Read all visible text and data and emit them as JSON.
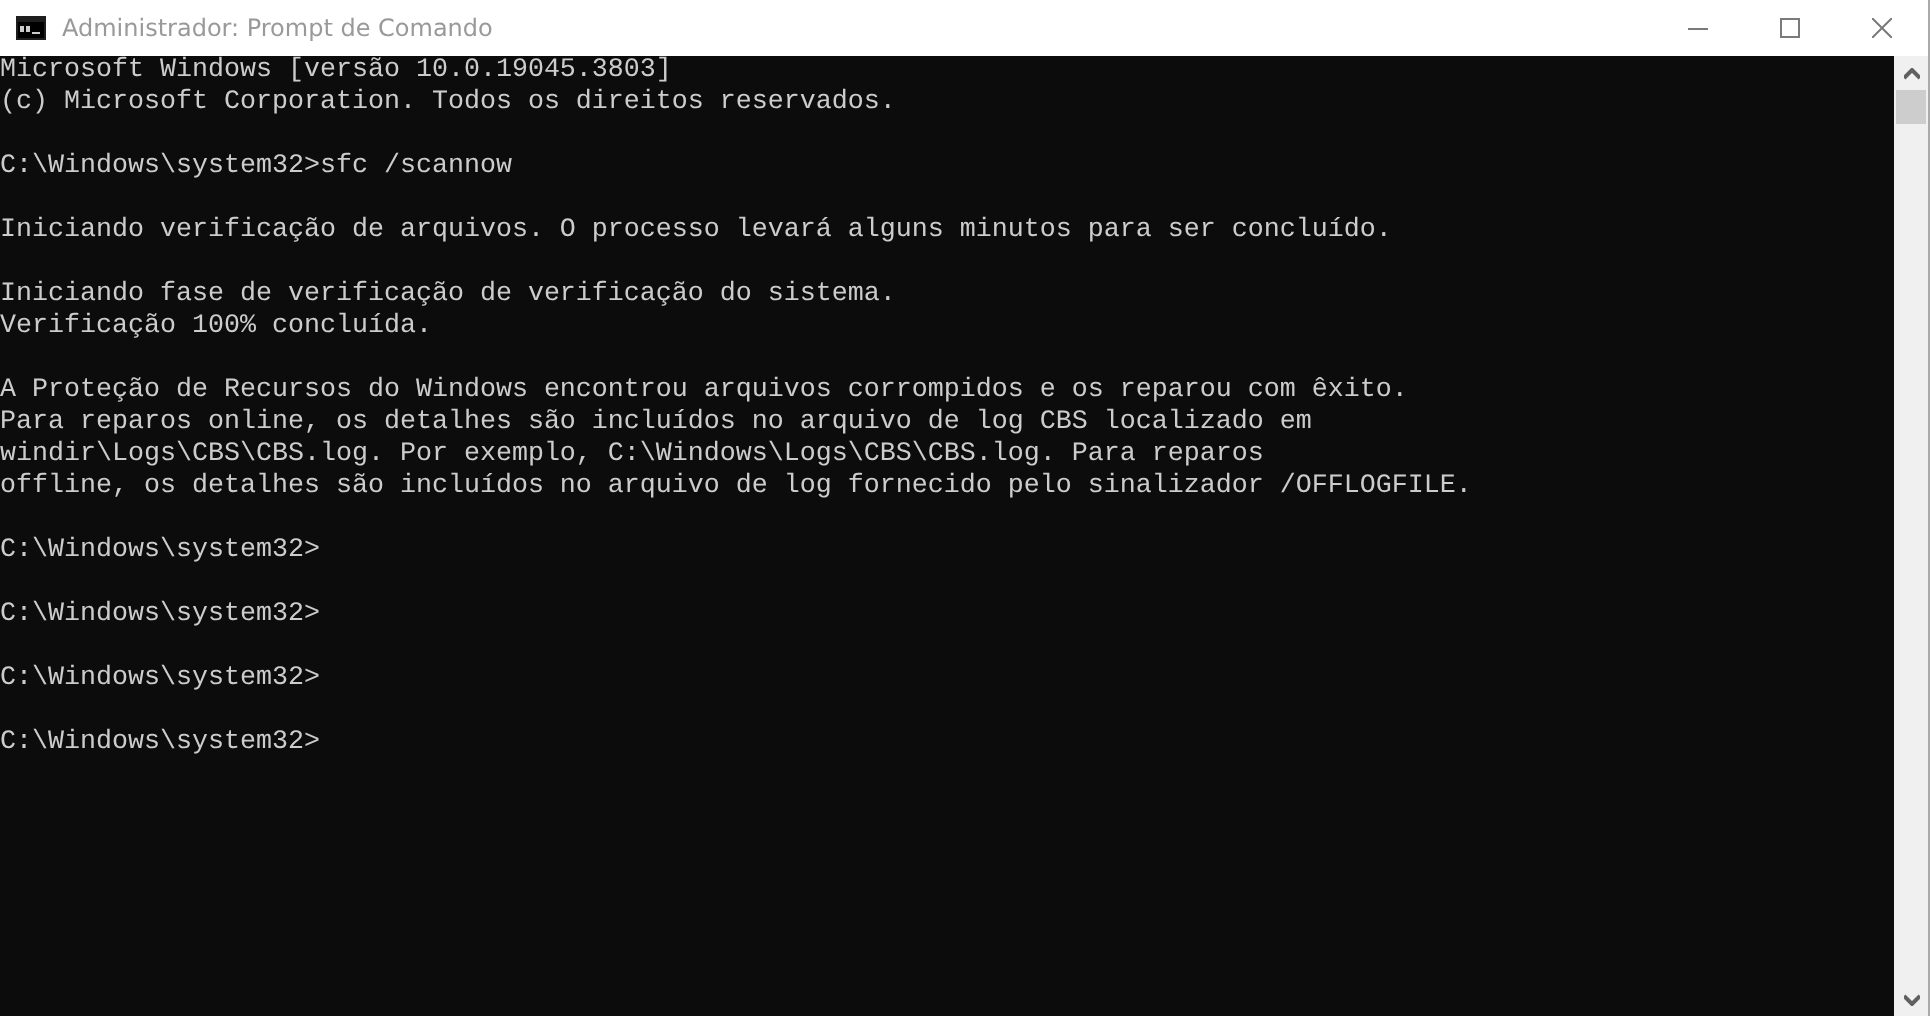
{
  "window": {
    "title": "Administrador: Prompt de Comando"
  },
  "console": {
    "blocks": [
      [
        "Microsoft Windows [versão 10.0.19045.3803]",
        "(c) Microsoft Corporation. Todos os direitos reservados."
      ],
      [
        "C:\\Windows\\system32>sfc /scannow"
      ],
      [
        "Iniciando verificação de arquivos. O processo levará alguns minutos para ser concluído."
      ],
      [
        "Iniciando fase de verificação de verificação do sistema.",
        "Verificação 100% concluída."
      ],
      [
        "A Proteção de Recursos do Windows encontrou arquivos corrompidos e os reparou com êxito.",
        "Para reparos online, os detalhes são incluídos no arquivo de log CBS localizado em",
        "windir\\Logs\\CBS\\CBS.log. Por exemplo, C:\\Windows\\Logs\\CBS\\CBS.log. Para reparos",
        "offline, os detalhes são incluídos no arquivo de log fornecido pelo sinalizador /OFFLOGFILE."
      ],
      [
        "C:\\Windows\\system32>"
      ],
      [
        "C:\\Windows\\system32>"
      ],
      [
        "C:\\Windows\\system32>"
      ],
      [
        "C:\\Windows\\system32>"
      ]
    ]
  }
}
